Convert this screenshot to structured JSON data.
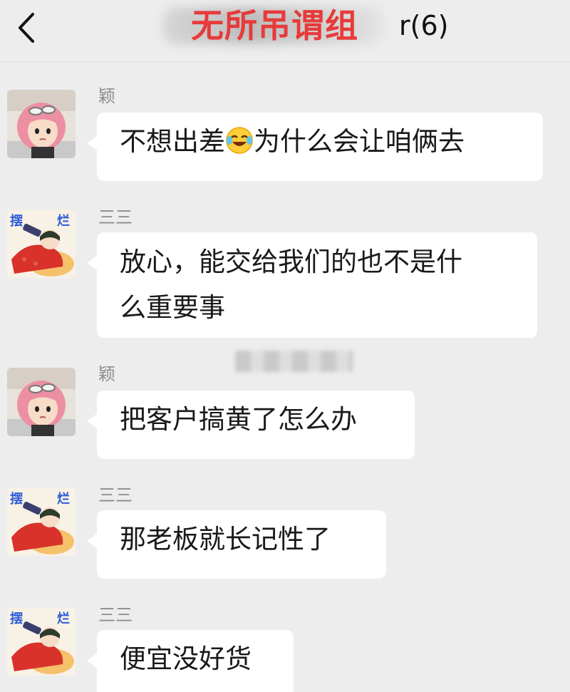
{
  "header": {
    "title_overlay": "无所吊谓组",
    "title_count": "r(6)"
  },
  "messages": [
    {
      "sender": "颖",
      "text_before": "不想出差",
      "text_after": "为什么会让咱俩去",
      "emoji": "laughing-tears-emoji"
    },
    {
      "sender": "三三",
      "lines": [
        "放心，能交给我们的也不是什",
        "么重要事"
      ]
    },
    {
      "sender": "颖",
      "text": "把客户搞黄了怎么办"
    },
    {
      "sender": "三三",
      "text": "那老板就长记性了"
    },
    {
      "sender": "三三",
      "text": "便宜没好货"
    }
  ],
  "avatars": {
    "ying": {
      "icon": "pink-hair-girl-avatar"
    },
    "sansan": {
      "icon": "lying-flat-avatar",
      "badge_left": "摆",
      "badge_right": "烂"
    }
  },
  "colors": {
    "background": "#ededed",
    "bubble": "#ffffff",
    "title_overlay": "#e73a3a",
    "sender": "#8c8c8c"
  }
}
